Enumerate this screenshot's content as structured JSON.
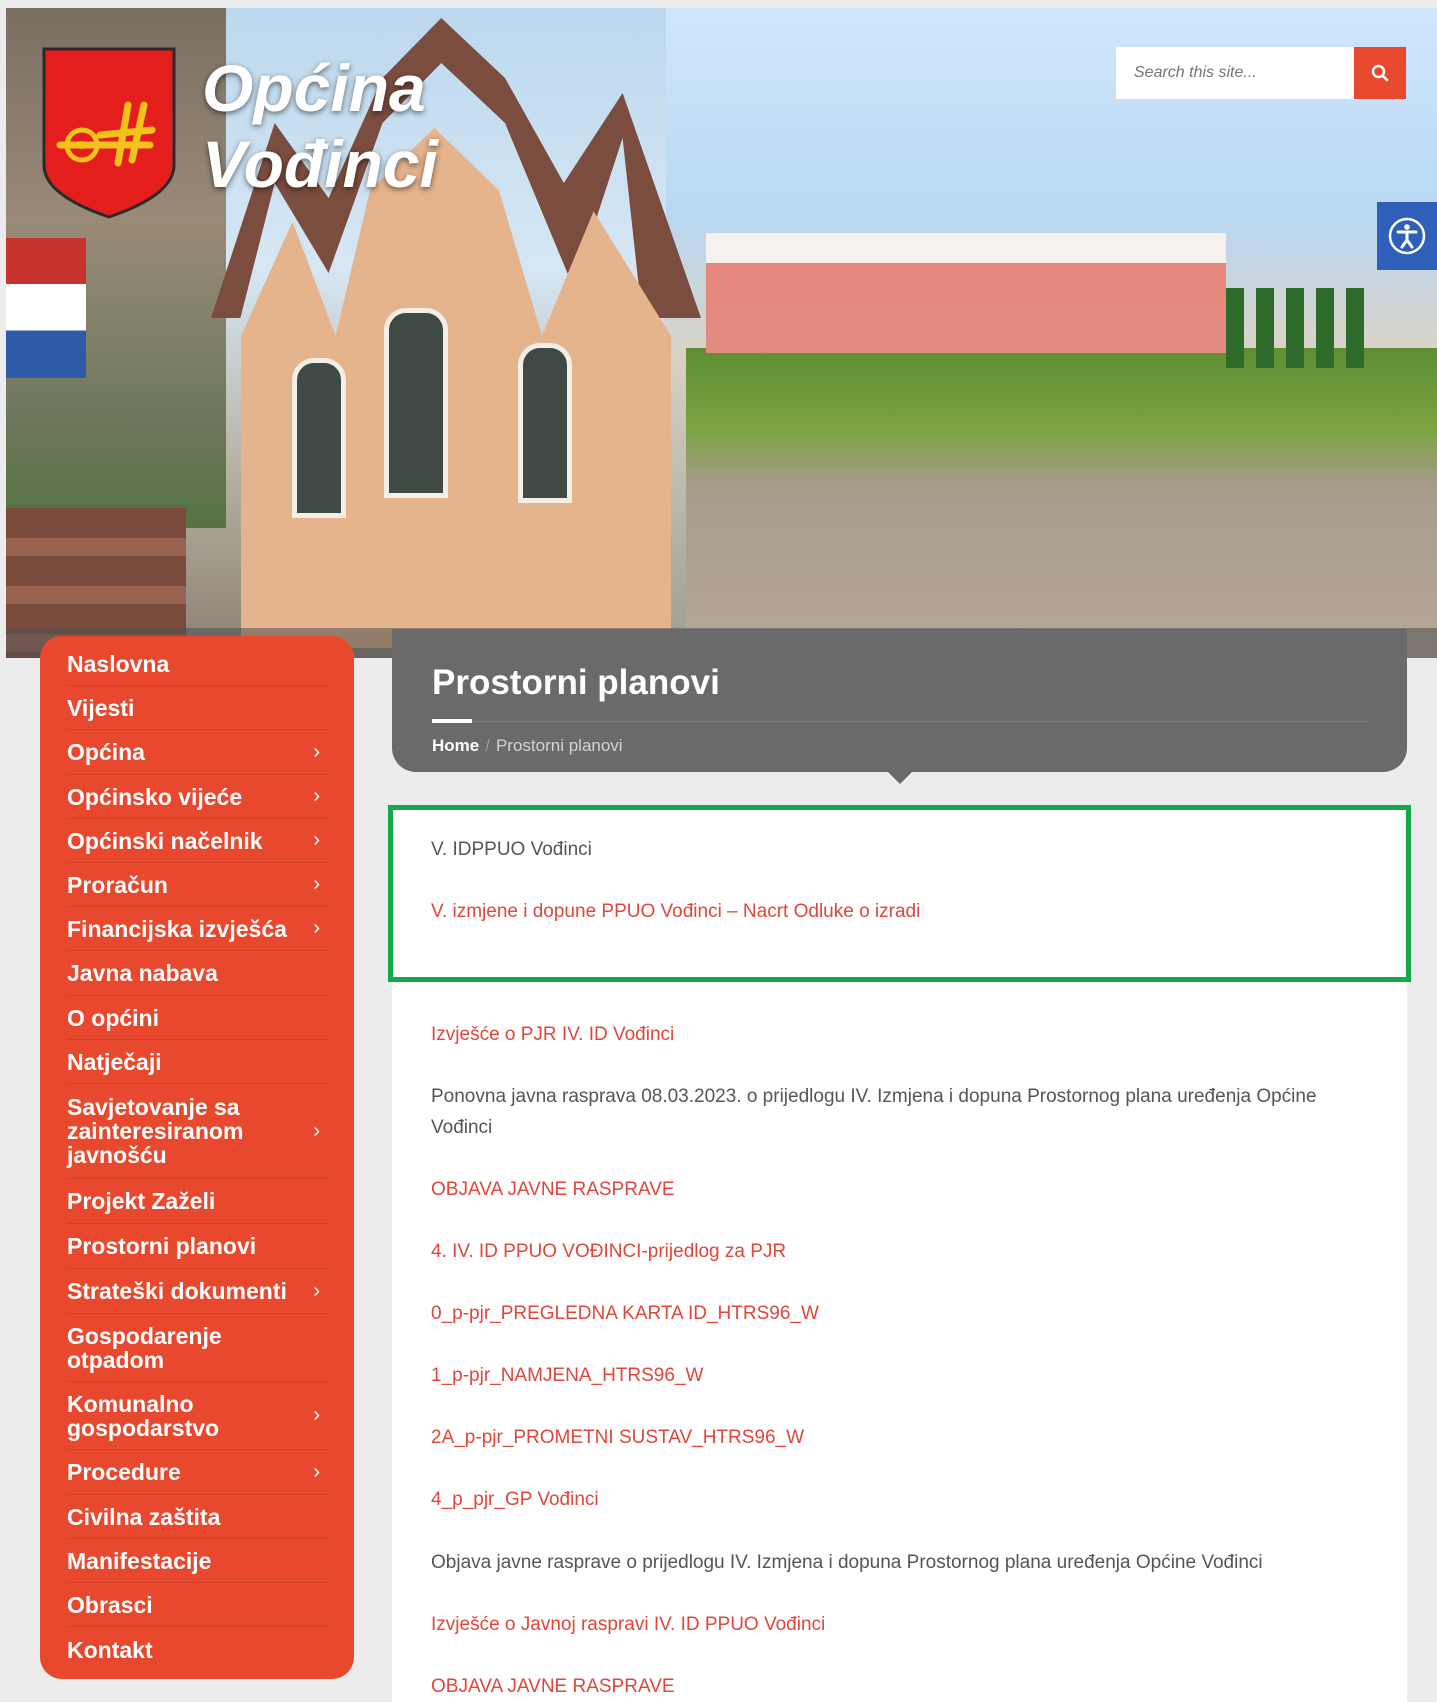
{
  "site": {
    "title_line1": "Općina",
    "title_line2": "Vođinci"
  },
  "search": {
    "placeholder": "Search this site...",
    "icon": "search-icon"
  },
  "accessibility": {
    "icon": "accessibility-icon"
  },
  "sidebar": {
    "items": [
      {
        "label": "Naslovna",
        "submenu": false
      },
      {
        "label": "Vijesti",
        "submenu": false
      },
      {
        "label": "Općina",
        "submenu": true
      },
      {
        "label": "Općinsko vijeće",
        "submenu": true
      },
      {
        "label": "Općinski načelnik",
        "submenu": true
      },
      {
        "label": "Proračun",
        "submenu": true
      },
      {
        "label": "Financijska izvješća",
        "submenu": true
      },
      {
        "label": "Javna nabava",
        "submenu": false
      },
      {
        "label": "O općini",
        "submenu": false
      },
      {
        "label": "Natječaji",
        "submenu": false
      },
      {
        "label": "Savjetovanje sa zainteresiranom javnošću",
        "submenu": true
      },
      {
        "label": "Projekt Zaželi",
        "submenu": false
      },
      {
        "label": "Prostorni planovi",
        "submenu": false
      },
      {
        "label": "Strateški dokumenti",
        "submenu": true
      },
      {
        "label": "Gospodarenje otpadom",
        "submenu": false
      },
      {
        "label": "Komunalno gospodarstvo",
        "submenu": true
      },
      {
        "label": "Procedure",
        "submenu": true
      },
      {
        "label": "Civilna zaštita",
        "submenu": false
      },
      {
        "label": "Manifestacije",
        "submenu": false
      },
      {
        "label": "Obrasci",
        "submenu": false
      },
      {
        "label": "Kontakt",
        "submenu": false
      }
    ],
    "arrow_glyph": "›"
  },
  "page": {
    "title": "Prostorni planovi",
    "breadcrumb_home": "Home",
    "breadcrumb_sep": "/",
    "breadcrumb_current": "Prostorni planovi"
  },
  "content": {
    "items": [
      {
        "text": "V. IDPPUO Vođinci",
        "link": false
      },
      {
        "text": "V. izmjene i dopune PPUO Vođinci – Nacrt Odluke o izradi",
        "link": true
      },
      {
        "text": "Izvješće o PJR IV. ID Vođinci",
        "link": true
      },
      {
        "text": "Ponovna javna rasprava 08.03.2023. o prijedlogu IV. Izmjena i dopuna Prostornog plana uređenja Općine Vođinci",
        "link": false
      },
      {
        "text": "OBJAVA JAVNE RASPRAVE",
        "link": true
      },
      {
        "text": "4. IV. ID PPUO VOĐINCI-prijedlog za PJR",
        "link": true
      },
      {
        "text": "0_p-pjr_PREGLEDNA KARTA ID_HTRS96_W",
        "link": true
      },
      {
        "text": "1_p-pjr_NAMJENA_HTRS96_W",
        "link": true
      },
      {
        "text": "2A_p-pjr_PROMETNI SUSTAV_HTRS96_W",
        "link": true
      },
      {
        "text": "4_p_pjr_GP Vođinci",
        "link": true
      },
      {
        "text": "Objava javne rasprave o prijedlogu IV. Izmjena i dopuna Prostornog plana uređenja Općine Vođinci",
        "link": false
      },
      {
        "text": "Izvješće o Javnoj raspravi IV. ID PPUO Vođinci",
        "link": true
      },
      {
        "text": "OBJAVA JAVNE RASPRAVE",
        "link": true
      }
    ]
  },
  "colors": {
    "accent": "#e8492e",
    "link": "#e0463a",
    "banner": "#6a6a6a",
    "highlight": "#13a84a",
    "accessibility": "#2f5fb8"
  }
}
